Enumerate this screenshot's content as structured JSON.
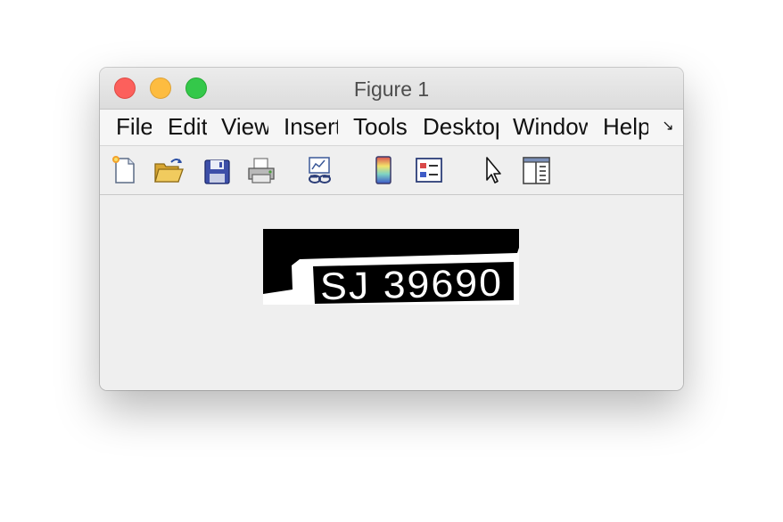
{
  "window": {
    "title": "Figure 1"
  },
  "menubar": {
    "items": [
      {
        "label": "File"
      },
      {
        "label": "Edit"
      },
      {
        "label": "View"
      },
      {
        "label": "Insert"
      },
      {
        "label": "Tools"
      },
      {
        "label": "Desktop"
      },
      {
        "label": "Window"
      },
      {
        "label": "Help"
      }
    ],
    "overflow_icon": "overflow-arrow-icon"
  },
  "toolbar": {
    "buttons": [
      {
        "icon": "new-figure-icon"
      },
      {
        "icon": "open-file-icon"
      },
      {
        "icon": "save-icon"
      },
      {
        "icon": "print-icon"
      },
      {
        "icon": "link-plot-icon"
      },
      {
        "icon": "colorbar-icon"
      },
      {
        "icon": "legend-icon"
      },
      {
        "icon": "pointer-icon"
      },
      {
        "icon": "property-inspector-icon"
      }
    ]
  },
  "figure": {
    "image_text": "SJ 39690",
    "image_description_colors": {
      "foreground": "#ffffff",
      "background": "#000000"
    }
  }
}
